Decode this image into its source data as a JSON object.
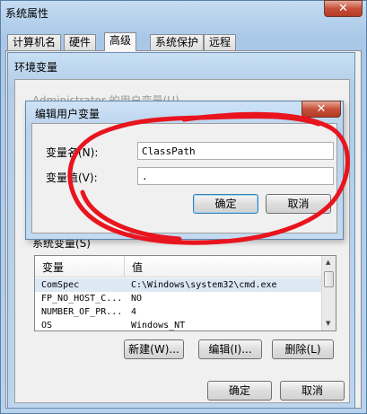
{
  "outer_window": {
    "title": "系统属性",
    "tabs": [
      "计算机名",
      "硬件",
      "高级",
      "系统保护",
      "远程"
    ],
    "active_tab": "高级"
  },
  "env_window": {
    "title": "环境变量",
    "user_vars_label": "Administrator 的用户变量(U)",
    "system_vars_label": "系统变量(S)",
    "columns": [
      "变量",
      "值"
    ],
    "rows": [
      {
        "name": "ComSpec",
        "value": "C:\\Windows\\system32\\cmd.exe"
      },
      {
        "name": "FP_NO_HOST_C...",
        "value": "NO"
      },
      {
        "name": "NUMBER_OF_PR...",
        "value": "4"
      },
      {
        "name": "OS",
        "value": "Windows_NT"
      }
    ],
    "buttons": {
      "new": "新建(W)...",
      "edit": "编辑(I)...",
      "delete": "删除(L)"
    },
    "ok": "确定",
    "cancel": "取消"
  },
  "edit_dialog": {
    "title": "编辑用户变量",
    "name_label": "变量名(N):",
    "value_label": "变量值(V):",
    "name_value": "ClassPath",
    "value_value": ".",
    "ok": "确定",
    "cancel": "取消"
  },
  "annotation": {
    "color": "#e8141e",
    "shape": "freehand-ellipse"
  }
}
